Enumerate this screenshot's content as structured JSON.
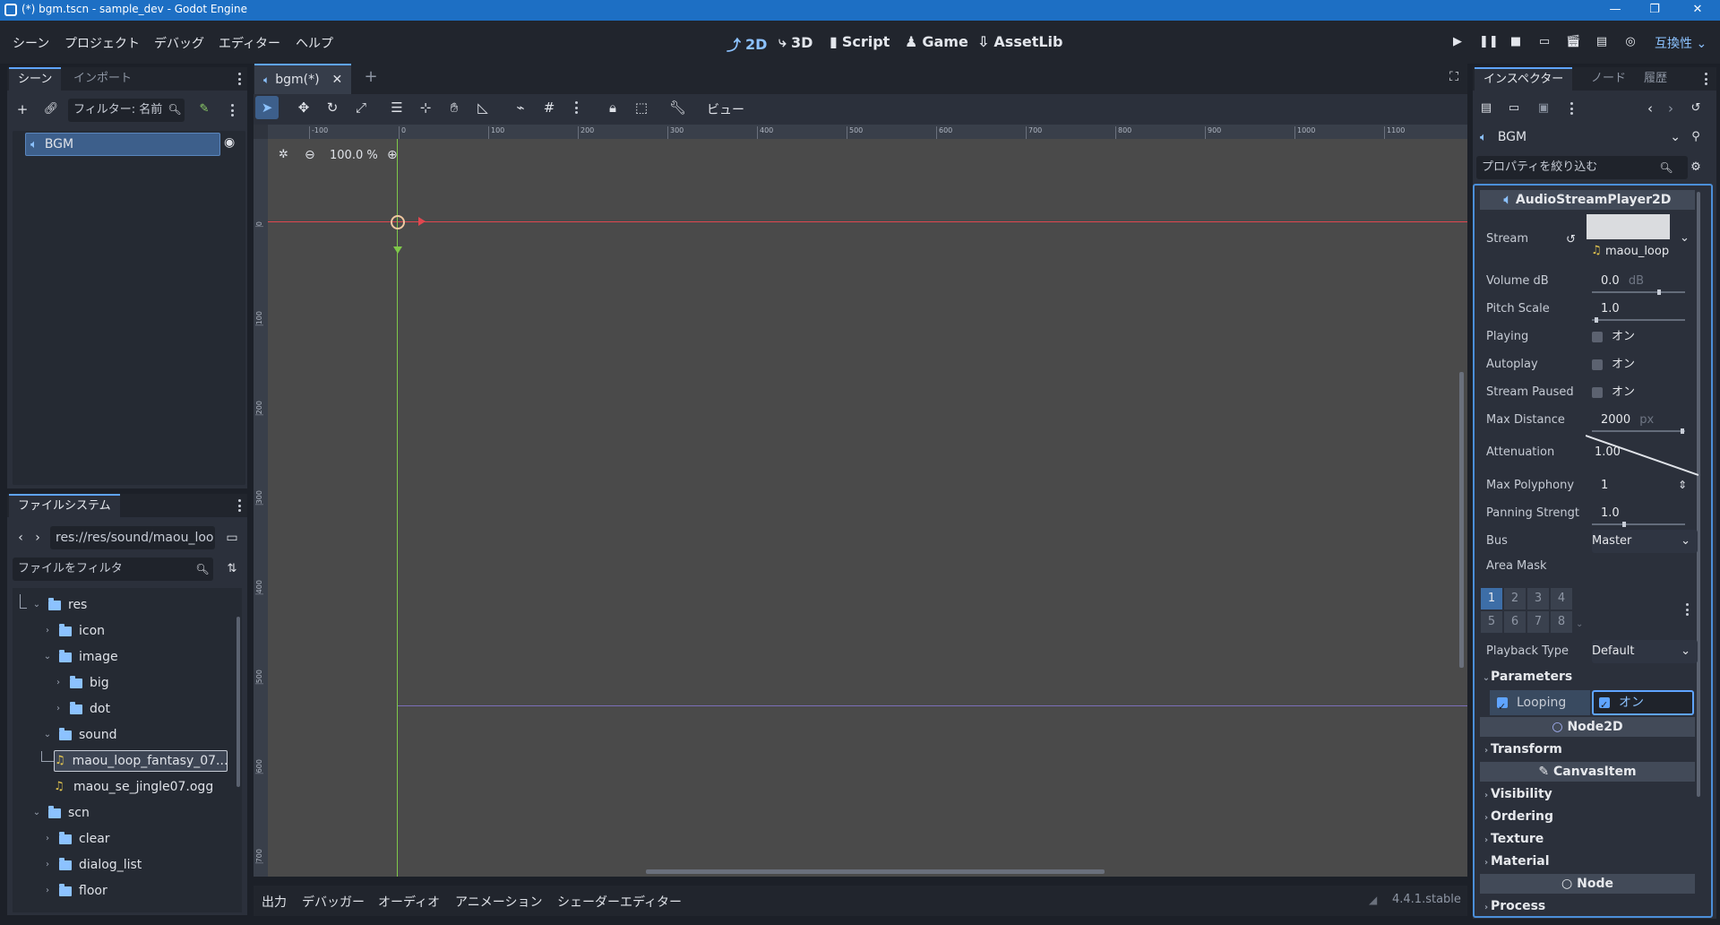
{
  "window": {
    "title": "(*) bgm.tscn - sample_dev - Godot Engine"
  },
  "menus": [
    "シーン",
    "プロジェクト",
    "デバッグ",
    "エディター",
    "ヘルプ"
  ],
  "workspaces": [
    "2D",
    "3D",
    "Script",
    "Game",
    "AssetLib"
  ],
  "compat_label": "互換性",
  "scene_dock": {
    "tabs": [
      "シーン",
      "インポート"
    ],
    "filter_placeholder": "フィルター: 名前",
    "root_node": "BGM"
  },
  "filesystem": {
    "tab": "ファイルシステム",
    "path": "res://res/sound/maou_loo",
    "filter_placeholder": "ファイルをフィルタ",
    "items": [
      {
        "label": "res",
        "type": "folder",
        "depth": 1,
        "expanded": true
      },
      {
        "label": "icon",
        "type": "folder",
        "depth": 2,
        "expanded": false
      },
      {
        "label": "image",
        "type": "folder",
        "depth": 2,
        "expanded": true
      },
      {
        "label": "big",
        "type": "folder",
        "depth": 3,
        "expanded": false
      },
      {
        "label": "dot",
        "type": "folder",
        "depth": 3,
        "expanded": false
      },
      {
        "label": "sound",
        "type": "folder",
        "depth": 2,
        "expanded": true
      },
      {
        "label": "maou_loop_fantasy_07....",
        "type": "audio",
        "depth": 3,
        "selected": true
      },
      {
        "label": "maou_se_jingle07.ogg",
        "type": "audio",
        "depth": 3
      },
      {
        "label": "scn",
        "type": "folder",
        "depth": 1,
        "expanded": true
      },
      {
        "label": "clear",
        "type": "folder",
        "depth": 2,
        "expanded": false
      },
      {
        "label": "dialog_list",
        "type": "folder",
        "depth": 2,
        "expanded": false
      },
      {
        "label": "floor",
        "type": "folder",
        "depth": 2,
        "expanded": false
      }
    ]
  },
  "editor": {
    "scene_tab": "bgm(*)",
    "view_menu": "ビュー",
    "zoom": "100.0 %",
    "ruler_h": [
      "-100",
      "0",
      "100",
      "200",
      "300",
      "400",
      "500",
      "600",
      "700",
      "800",
      "900",
      "1000",
      "1100"
    ],
    "ruler_v": [
      "0",
      "100",
      "200",
      "300",
      "400",
      "500",
      "600",
      "700"
    ]
  },
  "bottom_panel": {
    "tabs": [
      "出力",
      "デバッガー",
      "オーディオ",
      "アニメーション",
      "シェーダーエディター"
    ],
    "version": "4.4.1.stable"
  },
  "inspector": {
    "tabs": [
      "インスペクター",
      "ノード",
      "履歴"
    ],
    "object": "BGM",
    "filter_placeholder": "プロパティを絞り込む",
    "class": "AudioStreamPlayer2D",
    "stream": {
      "label": "Stream",
      "value": "maou_loop"
    },
    "props": {
      "volume": {
        "label": "Volume dB",
        "value": "0.0",
        "unit": "dB",
        "level": 0.7
      },
      "pitch": {
        "label": "Pitch Scale",
        "value": "1.0",
        "level": 0.03
      },
      "playing": {
        "label": "Playing",
        "value": "オン",
        "checked": false
      },
      "autoplay": {
        "label": "Autoplay",
        "value": "オン",
        "checked": false
      },
      "paused": {
        "label": "Stream Paused",
        "value": "オン",
        "checked": false
      },
      "max_distance": {
        "label": "Max Distance",
        "value": "2000",
        "unit": "px",
        "level": 0.95
      },
      "attenuation": {
        "label": "Attenuation",
        "value": "1.00"
      },
      "polyphony": {
        "label": "Max Polyphony",
        "value": "1"
      },
      "panning": {
        "label": "Panning Strengt",
        "value": "1.0",
        "level": 0.33
      },
      "bus": {
        "label": "Bus",
        "value": "Master"
      },
      "area_mask": {
        "label": "Area Mask",
        "layers": [
          "1",
          "2",
          "3",
          "4",
          "5",
          "6",
          "7",
          "8"
        ]
      },
      "playback_type": {
        "label": "Playback Type",
        "value": "Default"
      }
    },
    "parameters": {
      "label": "Parameters",
      "looping_label": "Looping",
      "looping_value": "オン"
    },
    "sections": {
      "node2d": "Node2D",
      "transform": "Transform",
      "canvasitem": "CanvasItem",
      "visibility": "Visibility",
      "ordering": "Ordering",
      "texture": "Texture",
      "material": "Material",
      "node": "Node",
      "process": "Process"
    }
  },
  "colors": {
    "accent": "#5fa4ff",
    "titlebar": "#1d6fc4",
    "x_axis": "#e0474f",
    "y_axis": "#7fc84a"
  }
}
